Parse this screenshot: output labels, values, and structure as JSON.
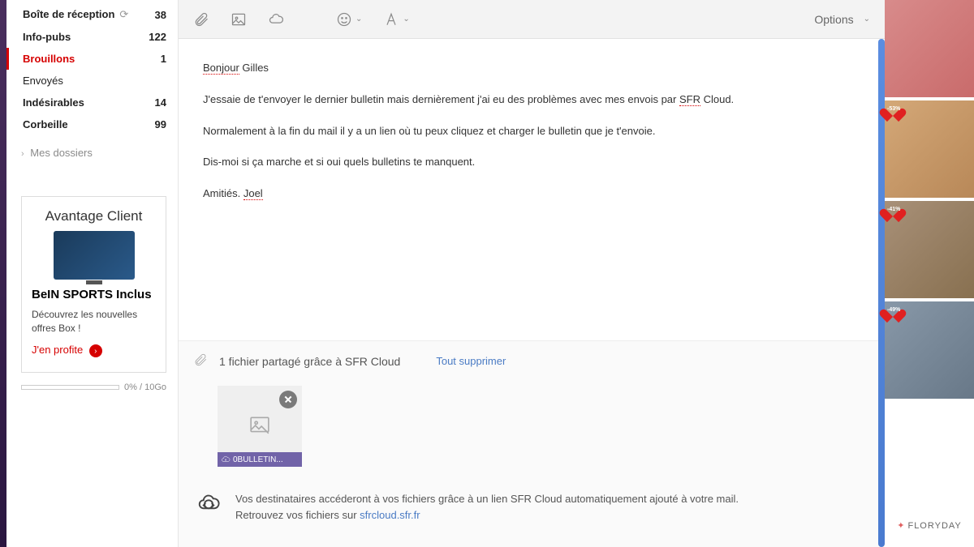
{
  "sidebar": {
    "folders": [
      {
        "name": "Boîte de réception",
        "count": "38",
        "bold": true,
        "refresh": true
      },
      {
        "name": "Info-pubs",
        "count": "122",
        "bold": true
      },
      {
        "name": "Brouillons",
        "count": "1",
        "bold": true,
        "active": true
      },
      {
        "name": "Envoyés",
        "count": "",
        "bold": false
      },
      {
        "name": "Indésirables",
        "count": "14",
        "bold": true
      },
      {
        "name": "Corbeille",
        "count": "99",
        "bold": true
      }
    ],
    "my_folders": "Mes dossiers",
    "ad": {
      "title": "Avantage Client",
      "bold": "BeIN SPORTS Inclus",
      "text": "Découvrez les nouvelles offres Box !",
      "cta": "J'en profite"
    },
    "storage": "0% / 10Go"
  },
  "toolbar": {
    "options": "Options"
  },
  "compose": {
    "lines": {
      "greeting_a": "Bonjour",
      "greeting_b": " Gilles",
      "l1a": "J'essaie de t'envoyer le dernier bulletin mais dernièrement j'ai eu des problèmes avec mes envois par ",
      "l1b": "SFR",
      "l1c": " Cloud.",
      "l2": "Normalement à la fin du mail il y a un lien où tu peux cliquez et charger le bulletin que je t'envoie.",
      "l3": "Dis-moi si ça marche et si oui quels bulletins te manquent.",
      "l4a": "Amitiés. ",
      "l4b": "Joel"
    }
  },
  "attach": {
    "title": "1 fichier partagé grâce à SFR Cloud",
    "delete_all": "Tout supprimer",
    "filename": "0BULLETIN...",
    "note1": "Vos destinataires accéderont à vos fichiers grâce à un lien SFR Cloud automatiquement ajouté à votre mail.",
    "note2": "Retrouvez vos fichiers sur ",
    "note_link": "sfrcloud.sfr.fr"
  },
  "rightads": {
    "badges": {
      "b2": "-53%",
      "b3": "-41%",
      "b4": "-49%"
    },
    "brand": "FLORYDAY"
  }
}
